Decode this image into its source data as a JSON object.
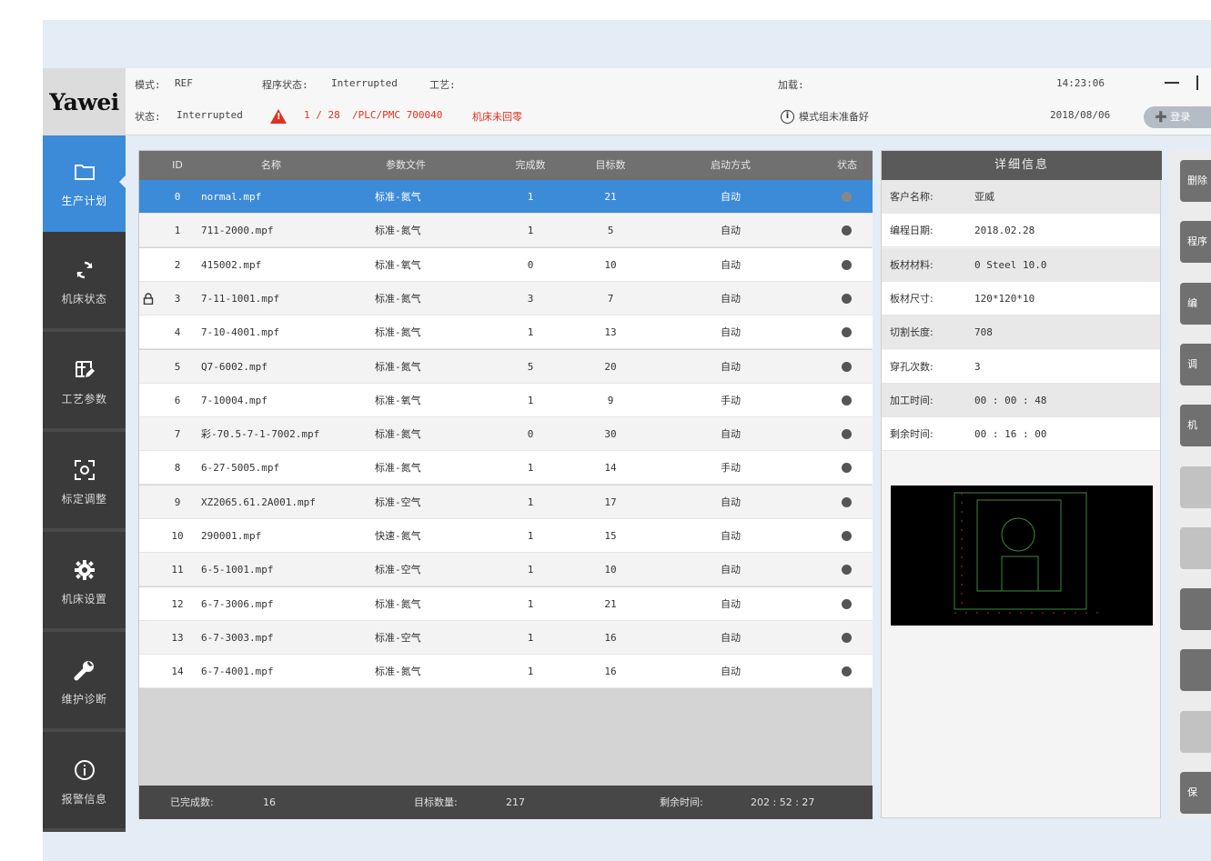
{
  "header": {
    "logo": "Yawei",
    "mode_label": "模式:",
    "mode_value": "REF",
    "program_status_label": "程序状态:",
    "program_status_value": "Interrupted",
    "process_label": "工艺:",
    "process_value": "",
    "status_label": "状态:",
    "status_value": "Interrupted",
    "alarm_count": "1 / 28",
    "alarm_code": "/PLC/PMC 700040",
    "alarm_text": "机床未回零",
    "loading_label": "加载:",
    "mode_message": "模式组未准备好",
    "time": "14:23:06",
    "date": "2018/08/06",
    "login_label": "登录"
  },
  "nav": [
    {
      "label": "生产计划",
      "icon": "folder-icon",
      "active": true
    },
    {
      "label": "机床状态",
      "icon": "refresh-icon",
      "active": false
    },
    {
      "label": "工艺参数",
      "icon": "edit-table-icon",
      "active": false
    },
    {
      "label": "标定调整",
      "icon": "target-icon",
      "active": false
    },
    {
      "label": "机床设置",
      "icon": "gear-icon",
      "active": false
    },
    {
      "label": "维护诊断",
      "icon": "wrench-icon",
      "active": false
    },
    {
      "label": "报警信息",
      "icon": "info-icon",
      "active": false
    }
  ],
  "table": {
    "columns": [
      "ID",
      "名称",
      "参数文件",
      "完成数",
      "目标数",
      "启动方式",
      "状态"
    ],
    "rows": [
      {
        "id": "0",
        "name": "normal.mpf",
        "param": "标准-氮气",
        "done": "1",
        "target": "21",
        "mode": "自动",
        "locked": false
      },
      {
        "id": "1",
        "name": "711-2000.mpf",
        "param": "标准-氮气",
        "done": "1",
        "target": "5",
        "mode": "自动",
        "locked": false
      },
      {
        "id": "2",
        "name": "415002.mpf",
        "param": "标准-氧气",
        "done": "0",
        "target": "10",
        "mode": "自动",
        "locked": false
      },
      {
        "id": "3",
        "name": "7-11-1001.mpf",
        "param": "标准-氮气",
        "done": "3",
        "target": "7",
        "mode": "自动",
        "locked": true
      },
      {
        "id": "4",
        "name": "7-10-4001.mpf",
        "param": "标准-氮气",
        "done": "1",
        "target": "13",
        "mode": "自动",
        "locked": false
      },
      {
        "id": "5",
        "name": "Q7-6002.mpf",
        "param": "标准-氮气",
        "done": "5",
        "target": "20",
        "mode": "自动",
        "locked": false
      },
      {
        "id": "6",
        "name": "7-10004.mpf",
        "param": "标准-氧气",
        "done": "1",
        "target": "9",
        "mode": "手动",
        "locked": false
      },
      {
        "id": "7",
        "name": "彩-70.5-7-1-7002.mpf",
        "param": "标准-氮气",
        "done": "0",
        "target": "30",
        "mode": "自动",
        "locked": false
      },
      {
        "id": "8",
        "name": "6-27-5005.mpf",
        "param": "标准-氮气",
        "done": "1",
        "target": "14",
        "mode": "手动",
        "locked": false
      },
      {
        "id": "9",
        "name": "XZ2065.61.2A001.mpf",
        "param": "标准-空气",
        "done": "1",
        "target": "17",
        "mode": "自动",
        "locked": false
      },
      {
        "id": "10",
        "name": "290001.mpf",
        "param": "快速-氮气",
        "done": "1",
        "target": "15",
        "mode": "自动",
        "locked": false
      },
      {
        "id": "11",
        "name": "6-5-1001.mpf",
        "param": "标准-空气",
        "done": "1",
        "target": "10",
        "mode": "自动",
        "locked": false
      },
      {
        "id": "12",
        "name": "6-7-3006.mpf",
        "param": "标准-氮气",
        "done": "1",
        "target": "21",
        "mode": "自动",
        "locked": false
      },
      {
        "id": "13",
        "name": "6-7-3003.mpf",
        "param": "标准-空气",
        "done": "1",
        "target": "16",
        "mode": "自动",
        "locked": false
      },
      {
        "id": "14",
        "name": "6-7-4001.mpf",
        "param": "标准-氮气",
        "done": "1",
        "target": "16",
        "mode": "自动",
        "locked": false
      }
    ],
    "selected_index": 0
  },
  "footer": {
    "done_label": "已完成数:",
    "done_value": "16",
    "target_label": "目标数量:",
    "target_value": "217",
    "remaining_label": "剩余时间:",
    "remaining_value": "202 : 52 : 27"
  },
  "detail": {
    "title": "详细信息",
    "rows": [
      {
        "key": "客户名称:",
        "value": "亚威"
      },
      {
        "key": "编程日期:",
        "value": "2018.02.28"
      },
      {
        "key": "板材材料:",
        "value": "0  Steel 10.0"
      },
      {
        "key": "板材尺寸:",
        "value": "120*120*10"
      },
      {
        "key": "切割长度:",
        "value": "708"
      },
      {
        "key": "穿孔次数:",
        "value": "3"
      },
      {
        "key": "加工时间:",
        "value": "00 : 00 : 48"
      },
      {
        "key": "剩余时间:",
        "value": "00 : 16 : 00"
      }
    ]
  },
  "right_buttons": [
    "删除",
    "程序",
    "编",
    "调",
    "机",
    "",
    "",
    "",
    "",
    "",
    "保"
  ]
}
